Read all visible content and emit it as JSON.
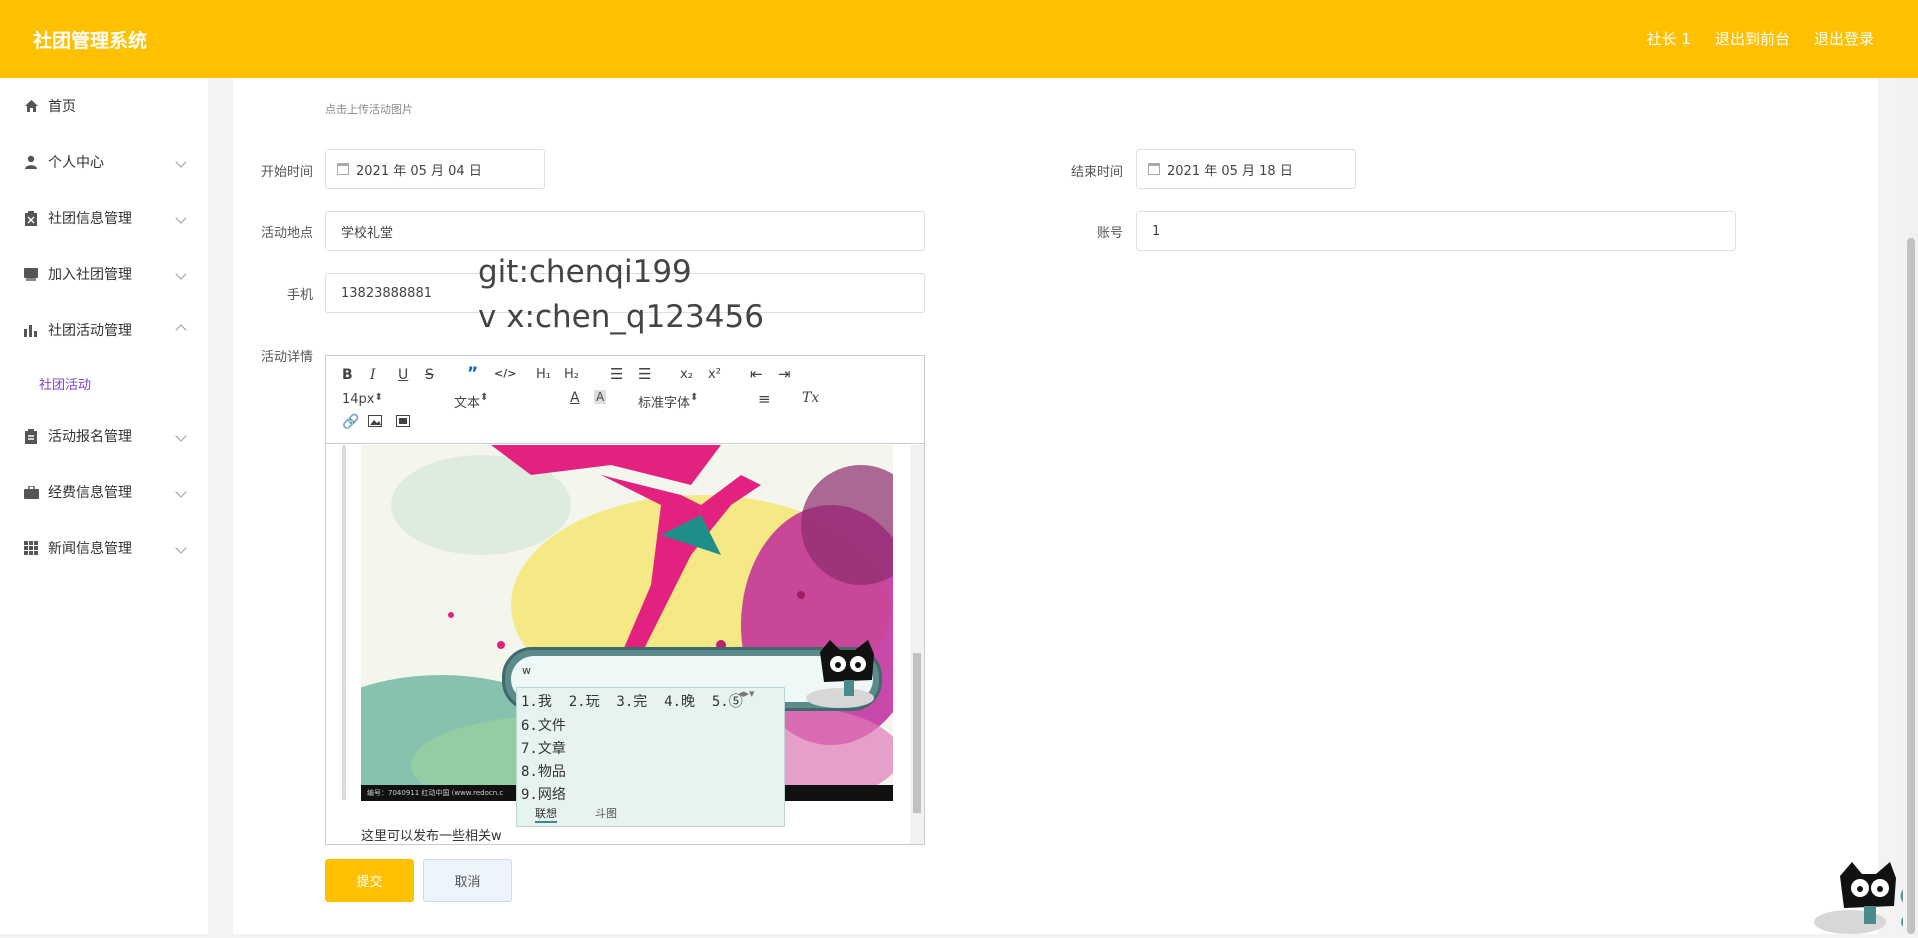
{
  "header": {
    "brand": "社团管理系统",
    "links": [
      "社长 1",
      "退出到前台",
      "退出登录"
    ]
  },
  "sidebar": {
    "items": [
      {
        "label": "首页",
        "icon": "home-icon"
      },
      {
        "label": "个人中心",
        "icon": "user-icon"
      },
      {
        "label": "社团信息管理",
        "icon": "clipboard-icon"
      },
      {
        "label": "加入社团管理",
        "icon": "book-icon"
      },
      {
        "label": "社团活动管理",
        "icon": "bar-chart-icon"
      },
      {
        "label": "活动报名管理",
        "icon": "clipboard-list-icon"
      },
      {
        "label": "经费信息管理",
        "icon": "briefcase-icon"
      },
      {
        "label": "新闻信息管理",
        "icon": "grid-icon"
      }
    ],
    "sub_item": "社团活动"
  },
  "form": {
    "upload_hint": "点击上传活动图片",
    "start_label": "开始时间",
    "start_value": "2021 年 05 月 04 日",
    "end_label": "结束时间",
    "end_value": "2021 年 05 月 18 日",
    "place_label": "活动地点",
    "place_value": "学校礼堂",
    "account_label": "账号",
    "account_value": "1",
    "phone_label": "手机",
    "phone_value": "13823888881",
    "detail_label": "活动详情"
  },
  "watermark": {
    "line1": "git:chenqi199",
    "line2": "v x:chen_q123456"
  },
  "editor": {
    "font_size": "14px",
    "block_format": "文本",
    "font_family": "标准字体",
    "body_text": "这里可以发布一些相关w",
    "image_caption": "编号：7040911   红动中国 (www.redocn.c"
  },
  "ime": {
    "input": "w",
    "row1": "1.我  2.玩  3.完  4.晚  5.⑤",
    "candidates": [
      "6.文件",
      "7.文章",
      "8.物品",
      "9.网络"
    ],
    "tabs": [
      "联想",
      "斗图"
    ]
  },
  "buttons": {
    "submit": "提交",
    "cancel": "取消"
  },
  "colors": {
    "accent": "#ffc000",
    "active_sub": "#7c3fd1"
  }
}
